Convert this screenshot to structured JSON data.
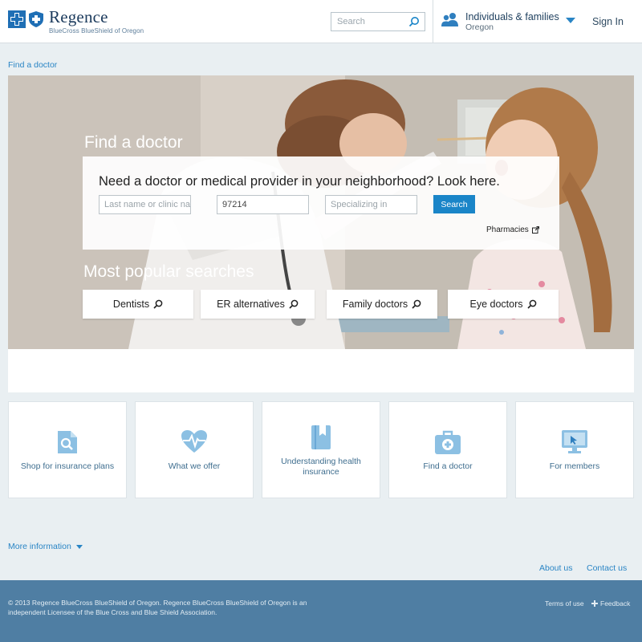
{
  "header": {
    "brand": "Regence",
    "tagline": "BlueCross BlueShield of Oregon",
    "search_placeholder": "Search",
    "audience_title": "Individuals & families",
    "audience_region": "Oregon",
    "sign_in": "Sign In"
  },
  "breadcrumb": "Find a doctor",
  "hero": {
    "title": "Find a doctor",
    "question": "Need a doctor or medical provider in your neighborhood? Look here.",
    "name_placeholder": "Last name or clinic na",
    "zip_value": "97214",
    "specialty_placeholder": "Specializing in",
    "search_button": "Search",
    "pharmacies": "Pharmacies",
    "popular_title": "Most popular searches",
    "popular": [
      "Dentists",
      "ER alternatives",
      "Family doctors",
      "Eye doctors"
    ]
  },
  "cards": [
    {
      "label": "Shop for insurance plans",
      "icon": "magnifier-document-icon"
    },
    {
      "label": "What we offer",
      "icon": "heart-pulse-icon"
    },
    {
      "label": "Understanding health insurance",
      "icon": "book-icon"
    },
    {
      "label": "Find a doctor",
      "icon": "medical-bag-icon"
    },
    {
      "label": "For members",
      "icon": "monitor-icon"
    }
  ],
  "more_information": "More information",
  "links": {
    "about": "About us",
    "contact": "Contact us"
  },
  "footer": {
    "copyright": "© 2013 Regence BlueCross BlueShield of Oregon. Regence BlueCross BlueShield of Oregon is an independent Licensee of the Blue Cross and Blue Shield Association.",
    "terms": "Terms of use",
    "feedback": "Feedback"
  },
  "colors": {
    "accent": "#1a85c8",
    "brand_navy": "#1b3a5c",
    "footer": "#4f7ea3",
    "page_bg": "#e9eff2",
    "icon_blue": "#7fb7dd"
  }
}
